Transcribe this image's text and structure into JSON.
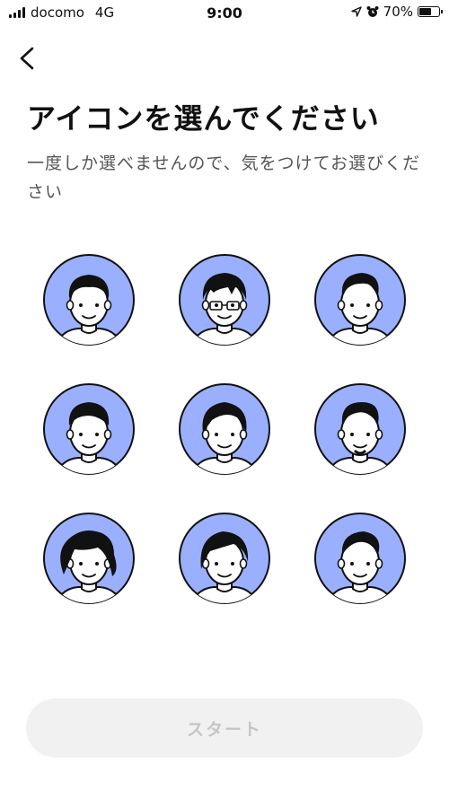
{
  "status_bar": {
    "carrier": "docomo",
    "network": "4G",
    "time": "9:00",
    "battery_percent": "70%",
    "battery_level": 0.7,
    "icons": [
      "signal-bars-icon",
      "location-arrow-icon",
      "alarm-clock-icon",
      "battery-icon"
    ]
  },
  "nav": {
    "back_icon": "chevron-left-icon"
  },
  "header": {
    "title": "アイコンを選んでください",
    "subtitle": "一度しか選べませんので、気をつけてお選びください"
  },
  "avatars": {
    "accent_color": "#9ab0ff",
    "items": [
      "avatar-1",
      "avatar-2",
      "avatar-3",
      "avatar-4",
      "avatar-5",
      "avatar-6",
      "avatar-7",
      "avatar-8",
      "avatar-9"
    ]
  },
  "footer": {
    "start_label": "スタート",
    "button_state": "disabled"
  }
}
